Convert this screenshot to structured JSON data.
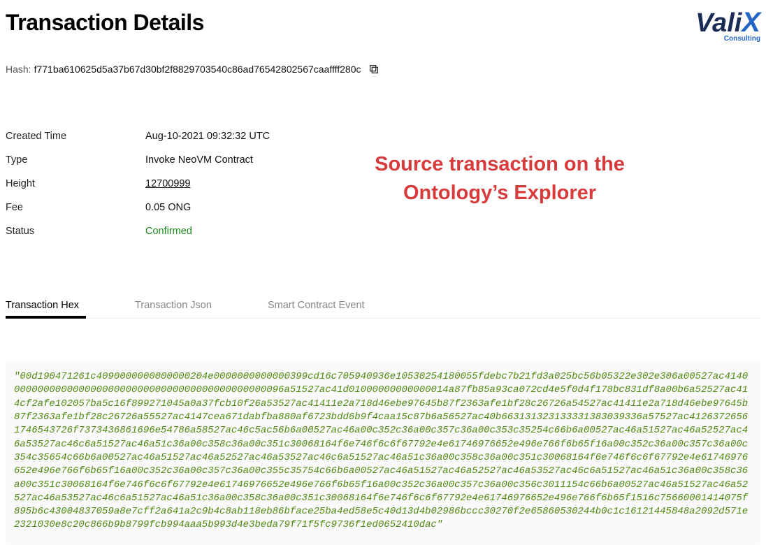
{
  "page": {
    "title": "Transaction Details"
  },
  "logo": {
    "prefix": "Vali",
    "accent": "X",
    "subtext": "Consulting"
  },
  "hash": {
    "label": "Hash: ",
    "value": "f771ba610625d5a37b67d30bf2f8829703540c86ad76542802567caaffff280c"
  },
  "details": {
    "created_time": {
      "label": "Created Time",
      "value": "Aug-10-2021 09:32:32 UTC"
    },
    "type": {
      "label": "Type",
      "value": "Invoke NeoVM Contract"
    },
    "height": {
      "label": "Height",
      "value": "12700999"
    },
    "fee": {
      "label": "Fee",
      "value": "0.05 ONG"
    },
    "status": {
      "label": "Status",
      "value": "Confirmed"
    }
  },
  "annotation": {
    "caption": "Source transaction on the Ontology’s Explorer"
  },
  "tabs": {
    "tx_hex": "Transaction Hex",
    "tx_json": "Transaction Json",
    "sc_event": "Smart Contract Event"
  },
  "tx_hex_content": "\"00d190471261c4090000000000000204e0000000000000399cd16c705940936e10530254180055fdebc7b21fd3a025bc56b05322e302e306a00527ac41400000000000000000000000000000000000000000000096a51527ac41d01000000000000014a87fb85a93ca072cd4e5f0d4f178bc831df8a00b6a52527ac414cf2afe102057ba5c16f899271045a0a37fcb10f26a53527ac41411e2a718d46ebe97645b87f2363afe1bf28c26726a54527ac41411e2a718d46ebe97645b87f2363afe1bf28c26726a55527ac4147cea671dabfba880af6723bdd6b9f4caa15c87b6a56527ac40b663131323133331383039336a57527ac41263726561746543726f7373436861696e54786a58527ac46c5ac56b6a00527ac46a00c352c36a00c357c36a00c353c35254c66b6a00527ac46a51527ac46a52527ac46a53527ac46c6a51527ac46a51c36a00c358c36a00c351c30068164f6e746f6c6f67792e4e61746976652e496e766f6b65f16a00c352c36a00c357c36a00c354c35654c66b6a00527ac46a51527ac46a52527ac46a53527ac46c6a51527ac46a51c36a00c358c36a00c351c30068164f6e746f6c6f67792e4e61746976652e496e766f6b65f16a00c352c36a00c357c36a00c355c35754c66b6a00527ac46a51527ac46a52527ac46a53527ac46c6a51527ac46a51c36a00c358c36a00c351c30068164f6e746f6c6f67792e4e61746976652e496e766f6b65f16a00c352c36a00c357c36a00c356c3011154c66b6a00527ac46a51527ac46a52527ac46a53527ac46c6a51527ac46a51c36a00c358c36a00c351c30068164f6e746f6c6f67792e4e61746976652e496e766f6b65f1516c75660001414075f895b6c43004837059a8e7cff2a641a2c9b4c8ab118eb86bface25ba4ed58e5c40d13d4b02986bccc30270f2e65860530244b0c1c16121445848a2092d571e2321030e8c20c866b9b8799fcb994aaa5b993d4e3beda79f71f5fc9736f1ed0652410dac\""
}
